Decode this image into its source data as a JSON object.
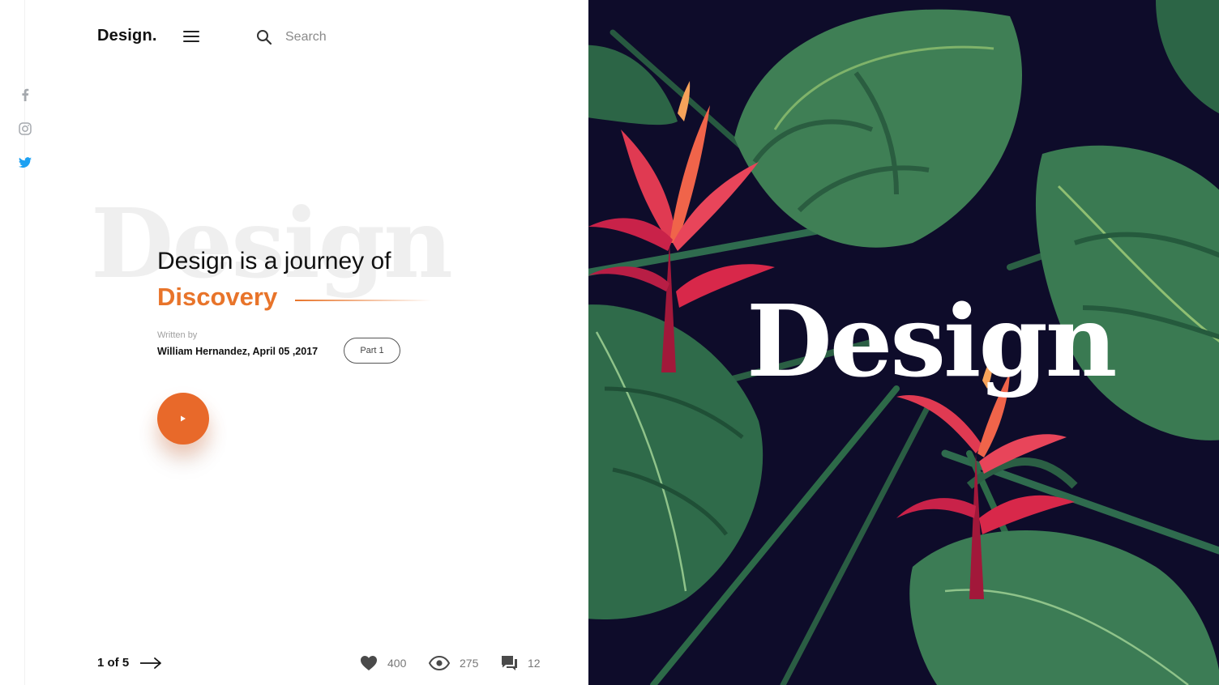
{
  "header": {
    "brand": "Design.",
    "menu_icon": "hamburger-menu-icon",
    "search_icon": "search-icon",
    "search_placeholder": "Search"
  },
  "social": [
    {
      "icon": "facebook-icon",
      "color": "#9aa0a6"
    },
    {
      "icon": "instagram-icon",
      "color": "#9aa0a6"
    },
    {
      "icon": "twitter-icon",
      "color": "#1da1f2"
    }
  ],
  "article": {
    "ghost_word": "Design",
    "headline_line1": "Design is a journey of",
    "headline_line2": "Discovery",
    "written_by_label": "Written by",
    "author_date": "William Hernandez,  April 05 ,2017",
    "part_label": "Part 1",
    "play_icon": "play-icon"
  },
  "footer": {
    "pager": "1 of 5",
    "next_icon": "arrow-right-icon",
    "likes": "400",
    "views": "275",
    "comments": "12",
    "likes_icon": "heart-icon",
    "views_icon": "eye-icon",
    "comments_icon": "comment-icon"
  },
  "hero": {
    "title": "Design",
    "background_color": "#0e0c2a"
  },
  "colors": {
    "accent": "#e8742a",
    "text": "#111111",
    "muted": "#8a8a8a"
  }
}
